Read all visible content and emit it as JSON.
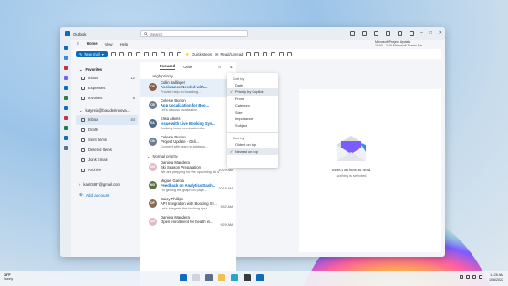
{
  "window": {
    "app_title": "Outlook",
    "search_placeholder": "Search"
  },
  "notification": {
    "line1": "Microsoft Project Update",
    "line2": "11:00 - 2:00 Microsoft Teams Me..."
  },
  "menu": {
    "tabs": [
      "Home",
      "View",
      "Help"
    ]
  },
  "ribbon": {
    "new_mail": "New mail",
    "quick_steps": "Quick steps",
    "read_unread": "Read/Unread"
  },
  "folders": {
    "favorites_label": "Favorites",
    "favorites": [
      {
        "name": "Inbox",
        "count": "12"
      },
      {
        "name": "Expenses",
        "count": ""
      },
      {
        "name": "Invoices",
        "count": "8"
      }
    ],
    "account1": "katyreid@boulderinnova...",
    "account1_items": [
      {
        "name": "Inbox",
        "count": "44"
      },
      {
        "name": "Drafts",
        "count": ""
      },
      {
        "name": "Sent Items",
        "count": ""
      },
      {
        "name": "Deleted Items",
        "count": ""
      },
      {
        "name": "Junk Email",
        "count": ""
      },
      {
        "name": "Archive",
        "count": ""
      }
    ],
    "account2": "katri0487@gmail.com",
    "add_account": "Add account"
  },
  "message_list": {
    "tab_focused": "Focused",
    "tab_other": "Other",
    "group_high": "High priority",
    "group_normal": "Normal priority",
    "messages": [
      {
        "initials": "CB",
        "avatar_color": "#8a5a44",
        "sender": "Colin Ballinger",
        "subject": "Assistance Needed with...",
        "preview": "Provide help on boarding...",
        "time": "",
        "style": "blue",
        "selected": true,
        "unread": true
      },
      {
        "initials": "CB",
        "avatar_color": "#6b7a8c",
        "sender": "Celeste Burton",
        "subject": "App Localization for Boo...",
        "preview": "Let's discuss localization",
        "time": "",
        "style": "blue",
        "selected": false,
        "unread": true
      },
      {
        "initials": "EA",
        "avatar_color": "#4f6b8a",
        "sender": "Elisa Atkins",
        "subject": "Issue with Live Booking Sys...",
        "preview": "Booking issue needs attention",
        "time": "",
        "style": "blue",
        "selected": false,
        "unread": false
      },
      {
        "initials": "CB",
        "avatar_color": "#6b7a8c",
        "sender": "Celeste Burton",
        "subject": "Project Update - Deli...",
        "preview": "Connect with team to address...",
        "time": "",
        "style": "plain",
        "selected": false,
        "unread": false
      },
      {
        "initials": "DM",
        "avatar_color": "#e3b6c8",
        "sender": "Daniela Mandera",
        "subject": "Ski Season Preparation",
        "preview": "We are prepping for the upcoming ski s...",
        "time": "10:29 AM",
        "style": "plain",
        "selected": false,
        "unread": false
      },
      {
        "initials": "MG",
        "avatar_color": "#5b6f45",
        "sender": "Miguel Garcia",
        "subject": "Feedback on Analytics Dash...",
        "preview": "I'm getting the graph on page...",
        "time": "10:18 AM",
        "style": "blue",
        "selected": false,
        "unread": true
      },
      {
        "initials": "DP",
        "avatar_color": "#8c6a4f",
        "sender": "Daisy Phillips",
        "subject": "API Integration with Booking Sy...",
        "preview": "Let's integrate the booking syst...",
        "time": "9:52 AM",
        "style": "plain",
        "selected": false,
        "unread": false
      },
      {
        "initials": "DM",
        "avatar_color": "#e3b6c8",
        "sender": "Daniela Mandera",
        "subject": "Open enrollment for health in...",
        "preview": "",
        "time": "9:29 AM",
        "style": "plain",
        "selected": false,
        "unread": false
      }
    ]
  },
  "sort_menu": {
    "sort_by_label": "Sort by",
    "sort_items": [
      "Date",
      "Priority by Copilot",
      "From",
      "Category",
      "Size",
      "Importance",
      "Subject"
    ],
    "selected_sort": "Priority by Copilot",
    "order_label": "Sort by",
    "order_items": [
      "Oldest on top",
      "Newest on top"
    ],
    "selected_order": "Newest on top"
  },
  "reading_pane": {
    "empty_title": "Select an item to read",
    "empty_subtitle": "Nothing is selected"
  },
  "taskbar": {
    "temperature": "78°F",
    "weather": "Sunny",
    "time": "11:25 AM",
    "date": "10/6/2022"
  }
}
